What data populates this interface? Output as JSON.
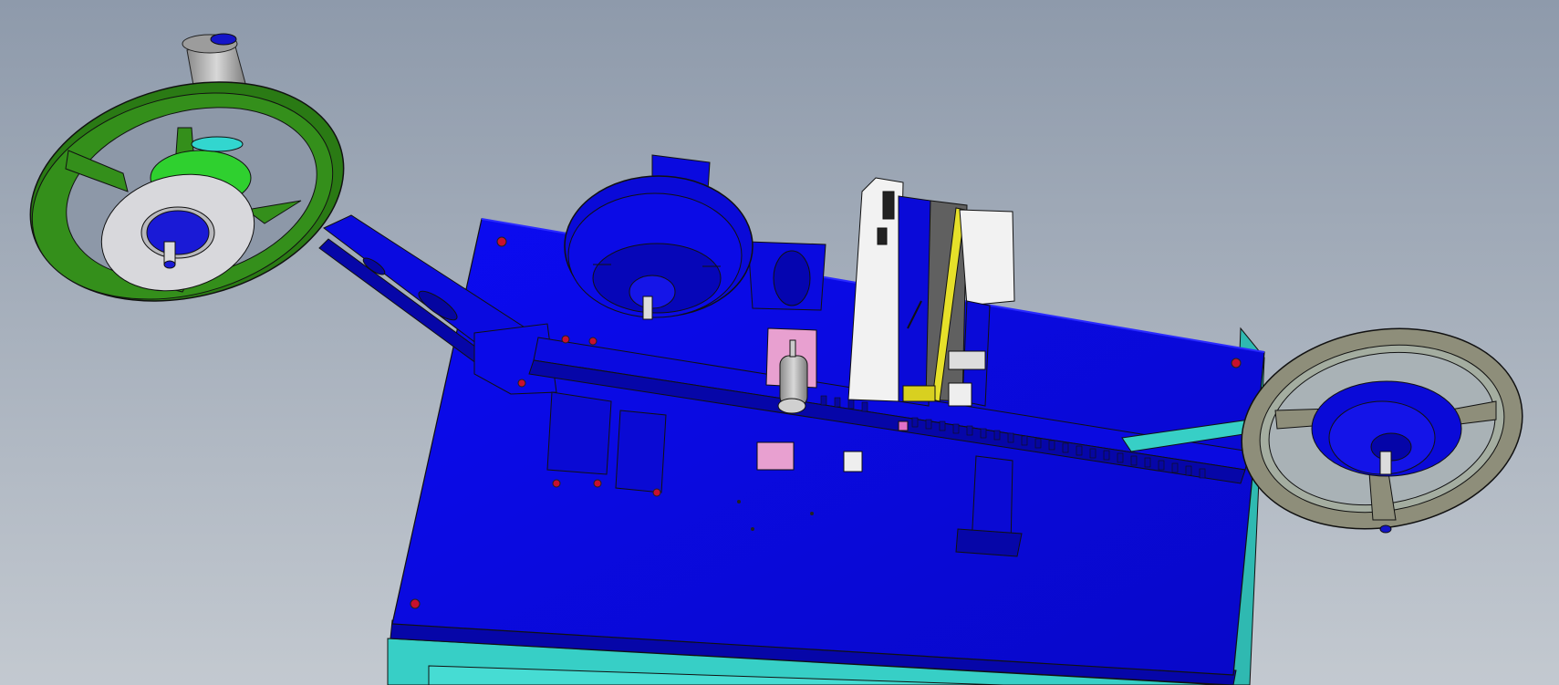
{
  "scene": {
    "kind": "cad-3d-assembly-view",
    "colors": {
      "background_top": "#8f9bac",
      "background_bottom": "#c2c8cf",
      "table_top": "#0a0aef",
      "table_side": "#36d1c8",
      "green_reel": "#2a7a14",
      "grey_reel": "#8e8e7a",
      "motor_silver": "#b8b8b8",
      "pink_block": "#e8a0d0",
      "yellow_rail": "#e6e02a",
      "white_housing": "#f2f2f2",
      "bolt_red": "#c8102e"
    },
    "parts": [
      "motor-icon",
      "supply-reel-icon",
      "take-up-reel-icon",
      "tape-spool-icon",
      "feeder-track-icon",
      "cutting-head-icon",
      "air-cylinder-icon"
    ]
  }
}
